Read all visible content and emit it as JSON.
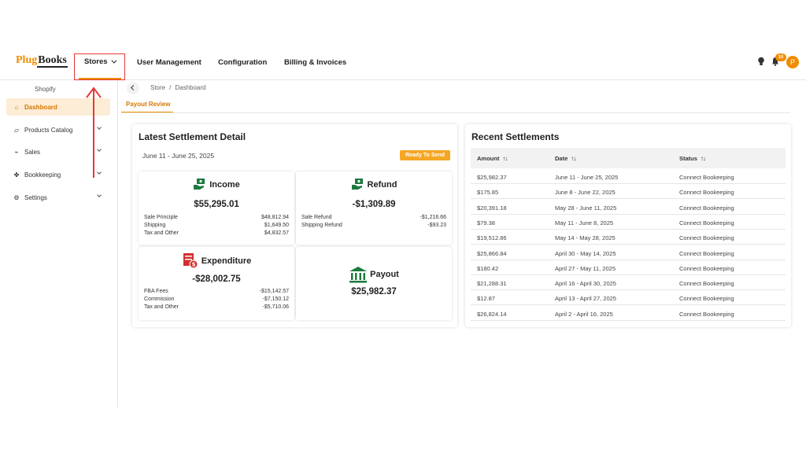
{
  "brand": {
    "part1": "Plug",
    "part2": "Books"
  },
  "topnav": {
    "stores": "Stores",
    "items": [
      "User Management",
      "Configuration",
      "Billing & Invoices"
    ],
    "notification_count": "10",
    "avatar_initial": "P"
  },
  "sidebar": {
    "store_name": "Shopify",
    "items": [
      {
        "label": "Dashboard",
        "icon": "home-icon"
      },
      {
        "label": "Products Catalog",
        "icon": "box-icon"
      },
      {
        "label": "Sales",
        "icon": "chart-icon"
      },
      {
        "label": "Bookkeeping",
        "icon": "book-icon"
      },
      {
        "label": "Settings",
        "icon": "gear-icon"
      }
    ]
  },
  "breadcrumb": {
    "store": "Store",
    "sep": "/",
    "page": "Dashboard"
  },
  "tab": "Payout Review",
  "latest": {
    "title": "Latest Settlement Detail",
    "date_range": "June 11 - June 25, 2025",
    "ready_button": "Ready To Send",
    "income": {
      "title": "Income",
      "amount": "$55,295.01",
      "rows": [
        {
          "label": "Sale Principle",
          "value": "$48,812.94"
        },
        {
          "label": "Shipping",
          "value": "$1,649.50"
        },
        {
          "label": "Tax and Other",
          "value": "$4,832.57"
        }
      ]
    },
    "refund": {
      "title": "Refund",
      "amount": "-$1,309.89",
      "rows": [
        {
          "label": "Sale Refund",
          "value": "-$1,216.66"
        },
        {
          "label": "Shipping Refund",
          "value": "-$93.23"
        }
      ]
    },
    "expenditure": {
      "title": "Expenditure",
      "amount": "-$28,002.75",
      "rows": [
        {
          "label": "FBA Fees",
          "value": "-$15,142.57"
        },
        {
          "label": "Commission",
          "value": "-$7,150.12"
        },
        {
          "label": "Tax and Other",
          "value": "-$5,710.06"
        }
      ]
    },
    "payout": {
      "title": "Payout",
      "amount": "$25,982.37"
    }
  },
  "recent": {
    "title": "Recent Settlements",
    "columns": [
      "Amount",
      "Date",
      "Status"
    ],
    "sort_glyph": "↑↓",
    "rows": [
      {
        "amount": "$25,982.37",
        "date": "June 11 - June 25, 2025",
        "status": "Connect Bookeeping"
      },
      {
        "amount": "$175.85",
        "date": "June 8 - June 22, 2025",
        "status": "Connect Bookeeping"
      },
      {
        "amount": "$20,391.18",
        "date": "May 28 - June 11, 2025",
        "status": "Connect Bookeeping"
      },
      {
        "amount": "$79.38",
        "date": "May 11 - June 8, 2025",
        "status": "Connect Bookeeping"
      },
      {
        "amount": "$19,512.86",
        "date": "May 14 - May 28, 2025",
        "status": "Connect Bookeeping"
      },
      {
        "amount": "$25,866.84",
        "date": "April 30 - May 14, 2025",
        "status": "Connect Bookeeping"
      },
      {
        "amount": "$180.42",
        "date": "April 27 - May 11, 2025",
        "status": "Connect Bookeeping"
      },
      {
        "amount": "$21,288.31",
        "date": "April 16 - April 30, 2025",
        "status": "Connect Bookeeping"
      },
      {
        "amount": "$12.87",
        "date": "April 13 - April 27, 2025",
        "status": "Connect Bookeeping"
      },
      {
        "amount": "$26,824.14",
        "date": "April 2 - April 16, 2025",
        "status": "Connect Bookeeping"
      }
    ]
  },
  "colors": {
    "accent": "#f08c00",
    "annotation": "#e53935",
    "icon_green": "#1b7a3e",
    "icon_red": "#d32f2f"
  }
}
